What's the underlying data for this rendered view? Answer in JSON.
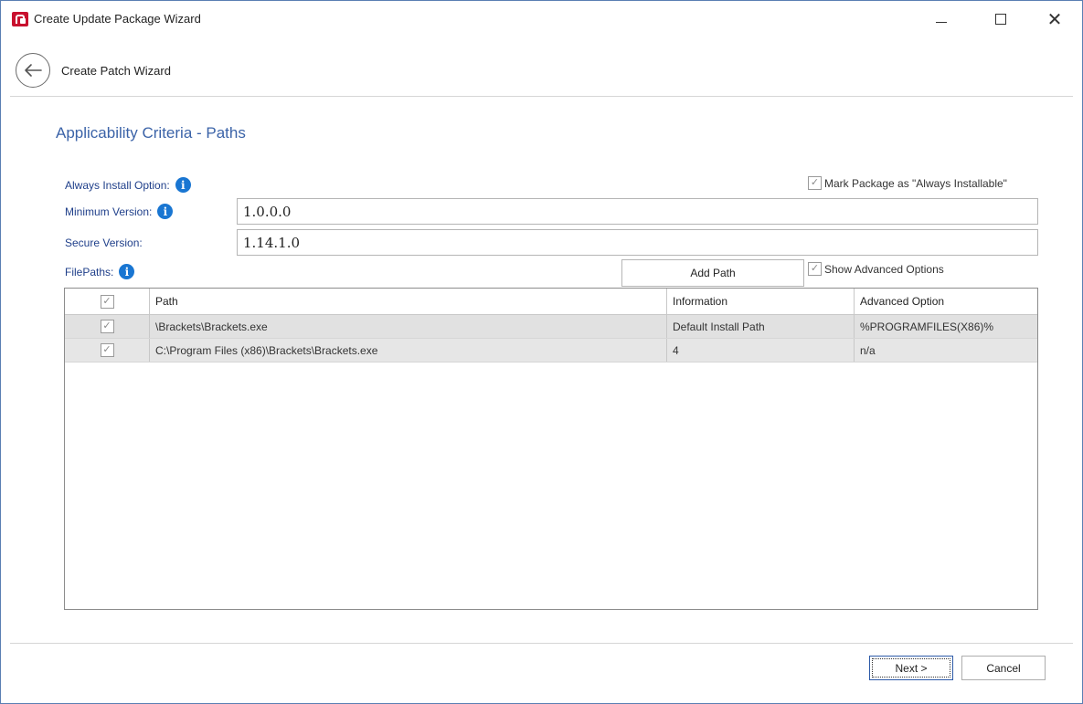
{
  "window": {
    "title": "Create Update Package Wizard"
  },
  "nav": {
    "back_label": "Create Patch Wizard"
  },
  "page": {
    "title": "Applicability Criteria - Paths"
  },
  "form": {
    "always_install_label": "Always Install Option:",
    "mark_always_installable_label": "Mark Package as \"Always Installable\"",
    "mark_always_installable_checked": true,
    "minimum_version_label": "Minimum Version:",
    "minimum_version_value": "1.0.0.0",
    "secure_version_label": "Secure Version:",
    "secure_version_value": "1.14.1.0",
    "filepaths_label": "FilePaths:",
    "add_path_label": "Add Path",
    "show_advanced_label": "Show Advanced Options",
    "show_advanced_checked": true
  },
  "grid": {
    "columns": [
      "",
      "Path",
      "Information",
      "Advanced Option"
    ],
    "rows": [
      {
        "checked": true,
        "path": "\\Brackets\\Brackets.exe",
        "information": "Default Install Path",
        "advanced_option": "%PROGRAMFILES(X86)%"
      },
      {
        "checked": true,
        "path": "C:\\Program Files (x86)\\Brackets\\Brackets.exe",
        "information": "4",
        "advanced_option": "n/a"
      }
    ]
  },
  "footer": {
    "next_label": "Next >",
    "cancel_label": "Cancel"
  },
  "icons": {
    "check": "✓",
    "info": "i",
    "close": "✕"
  },
  "colors": {
    "accent_title": "#3b63a8",
    "label_blue": "#1f3f8a",
    "info_blue": "#1976d2",
    "window_border": "#5a7fb3"
  }
}
